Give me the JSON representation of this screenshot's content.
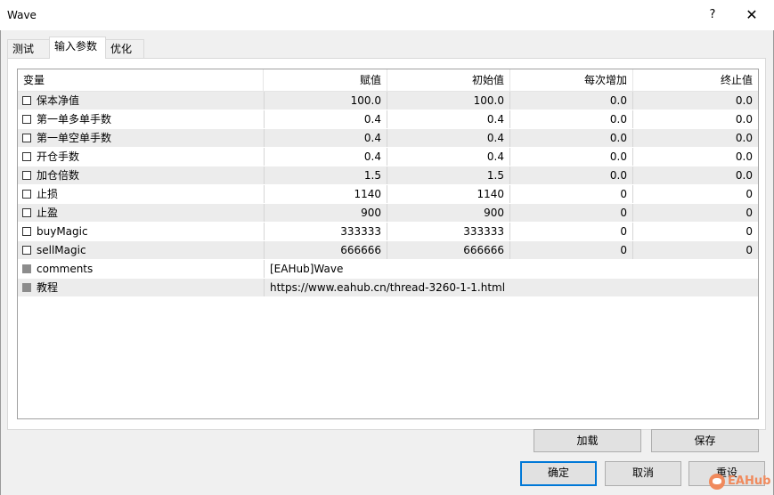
{
  "window": {
    "title": "Wave",
    "help_label": "?",
    "close_label": "✕"
  },
  "tabs": [
    {
      "label": "测试"
    },
    {
      "label": "输入参数"
    },
    {
      "label": "优化"
    }
  ],
  "table": {
    "headers": [
      "变量",
      "赋值",
      "初始值",
      "每次增加",
      "终止值"
    ],
    "rows": [
      {
        "name": "保本净值",
        "value": "100.0",
        "start": "100.0",
        "step": "0.0",
        "stop": "0.0"
      },
      {
        "name": "第一单多单手数",
        "value": "0.4",
        "start": "0.4",
        "step": "0.0",
        "stop": "0.0"
      },
      {
        "name": "第一单空单手数",
        "value": "0.4",
        "start": "0.4",
        "step": "0.0",
        "stop": "0.0"
      },
      {
        "name": "开仓手数",
        "value": "0.4",
        "start": "0.4",
        "step": "0.0",
        "stop": "0.0"
      },
      {
        "name": "加仓倍数",
        "value": "1.5",
        "start": "1.5",
        "step": "0.0",
        "stop": "0.0"
      },
      {
        "name": "止损",
        "value": "1140",
        "start": "1140",
        "step": "0",
        "stop": "0"
      },
      {
        "name": "止盈",
        "value": "900",
        "start": "900",
        "step": "0",
        "stop": "0"
      },
      {
        "name": "buyMagic",
        "value": "333333",
        "start": "333333",
        "step": "0",
        "stop": "0"
      },
      {
        "name": "sellMagic",
        "value": "666666",
        "start": "666666",
        "step": "0",
        "stop": "0"
      }
    ],
    "string_rows": [
      {
        "name": "comments",
        "value": "[EAHub]Wave"
      },
      {
        "name": "教程",
        "value": "https://www.eahub.cn/thread-3260-1-1.html"
      }
    ]
  },
  "buttons": {
    "load": "加载",
    "save": "保存",
    "ok": "确定",
    "cancel": "取消",
    "reset": "重设"
  },
  "watermark": {
    "text": "EAHub",
    "color": "#f08a5d"
  }
}
